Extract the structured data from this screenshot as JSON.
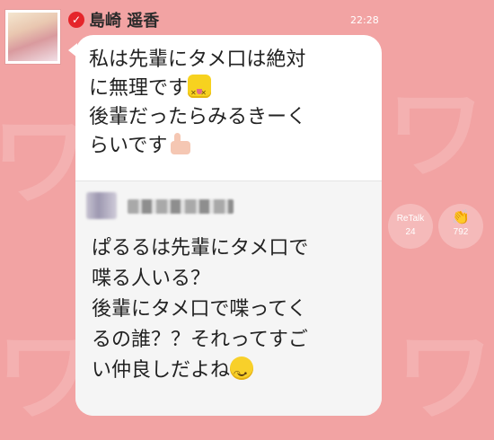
{
  "header": {
    "name": "島崎 遥香",
    "time": "22:28"
  },
  "post": {
    "lines": [
      "私は先輩にタメ口は絶対",
      "に無理です",
      "後輩だったらみるきーく",
      "らいです"
    ],
    "emoji_line2": "dizzy-face-emoji",
    "emoji_line4": "thumbs-up-emoji"
  },
  "quoted": {
    "author": "■■■■■",
    "lines": [
      "ぱるるは先輩にタメ口で",
      "喋る人いる？",
      "後輩にタメ口で喋ってく",
      "るの誰？？それってすご",
      "い仲良しだよね"
    ],
    "emoji_last": "winking-face-emoji"
  },
  "actions": {
    "retalk_label": "ReTalk",
    "retalk_count": "24",
    "clap_count": "792"
  },
  "colors": {
    "background": "#f2a3a3",
    "verified_badge": "#e5252a"
  }
}
